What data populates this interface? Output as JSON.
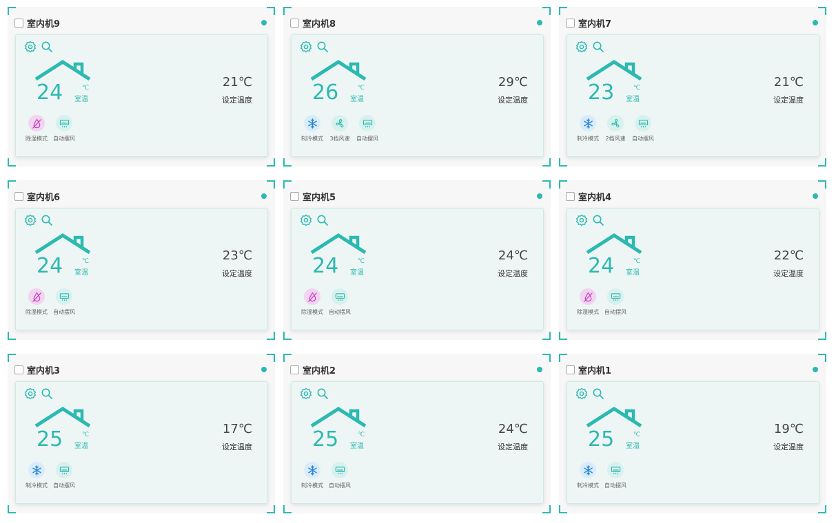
{
  "units": {
    "room_label": "室温",
    "degree_unit": "℃",
    "set_label": "设定温度"
  },
  "colors": {
    "accent": "#2cb9b1",
    "cool_bg": "#d9ecfb",
    "cool_fg": "#2a85d8",
    "fan_bg": "#d8f1ee",
    "swing_bg": "#d8f1ee",
    "dehum_bg": "#f2d3f0",
    "dehum_fg": "#c53ec0"
  },
  "units_list": [
    {
      "name": "室内机9",
      "room": "24",
      "set": "21℃",
      "modes": [
        {
          "icon": "dehumidify-icon",
          "label": "除湿模式"
        },
        {
          "icon": "swing-icon",
          "label": "自动摆风"
        }
      ]
    },
    {
      "name": "室内机8",
      "room": "26",
      "set": "29℃",
      "modes": [
        {
          "icon": "snowflake-icon",
          "label": "制冷模式"
        },
        {
          "icon": "fan-icon",
          "label": "3档风速"
        },
        {
          "icon": "swing-icon",
          "label": "自动摆风"
        }
      ]
    },
    {
      "name": "室内机7",
      "room": "23",
      "set": "21℃",
      "modes": [
        {
          "icon": "snowflake-icon",
          "label": "制冷模式"
        },
        {
          "icon": "fan-icon",
          "label": "2档风速"
        },
        {
          "icon": "swing-icon",
          "label": "自动摆风"
        }
      ]
    },
    {
      "name": "室内机6",
      "room": "24",
      "set": "23℃",
      "modes": [
        {
          "icon": "dehumidify-icon",
          "label": "除湿模式"
        },
        {
          "icon": "swing-icon",
          "label": "自动摆风"
        }
      ]
    },
    {
      "name": "室内机5",
      "room": "24",
      "set": "24℃",
      "modes": [
        {
          "icon": "dehumidify-icon",
          "label": "除湿模式"
        },
        {
          "icon": "swing-icon",
          "label": "自动摆风"
        }
      ]
    },
    {
      "name": "室内机4",
      "room": "24",
      "set": "22℃",
      "modes": [
        {
          "icon": "dehumidify-icon",
          "label": "除湿模式"
        },
        {
          "icon": "swing-icon",
          "label": "自动摆风"
        }
      ]
    },
    {
      "name": "室内机3",
      "room": "25",
      "set": "17℃",
      "modes": [
        {
          "icon": "snowflake-icon",
          "label": "制冷模式"
        },
        {
          "icon": "swing-icon",
          "label": "自动摆风"
        }
      ]
    },
    {
      "name": "室内机2",
      "room": "25",
      "set": "24℃",
      "modes": [
        {
          "icon": "snowflake-icon",
          "label": "制冷模式"
        },
        {
          "icon": "swing-icon",
          "label": "自动摆风"
        }
      ]
    },
    {
      "name": "室内机1",
      "room": "25",
      "set": "19℃",
      "modes": [
        {
          "icon": "snowflake-icon",
          "label": "制冷模式"
        },
        {
          "icon": "swing-icon",
          "label": "自动摆风"
        }
      ]
    }
  ]
}
